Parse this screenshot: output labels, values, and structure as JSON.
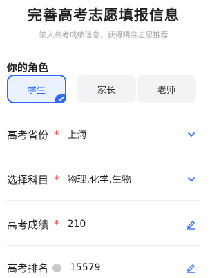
{
  "header": {
    "title": "完善高考志愿填报信息",
    "subtitle": "输入高考成绩信息，获得精准志愿推荐"
  },
  "role_section": {
    "label": "你的角色",
    "options": [
      {
        "label": "学生",
        "selected": true
      },
      {
        "label": "家长",
        "selected": false
      },
      {
        "label": "老师",
        "selected": false
      }
    ]
  },
  "fields": [
    {
      "label": "高考省份",
      "required": "*",
      "value": "上海",
      "icon": "chevron-down-icon"
    },
    {
      "label": "选择科目",
      "required": "*",
      "value": "物理,化学,生物",
      "icon": "chevron-down-icon"
    },
    {
      "label": "高考成绩",
      "required": "*",
      "value": "210",
      "icon": "edit-pencil-icon"
    },
    {
      "label": "高考排名",
      "info": "i",
      "value": "15579",
      "icon": "edit-pencil-icon"
    }
  ],
  "colors": {
    "accent": "#2f6bff",
    "required": "#e23b3b",
    "subtitle": "#a3a3a3"
  }
}
